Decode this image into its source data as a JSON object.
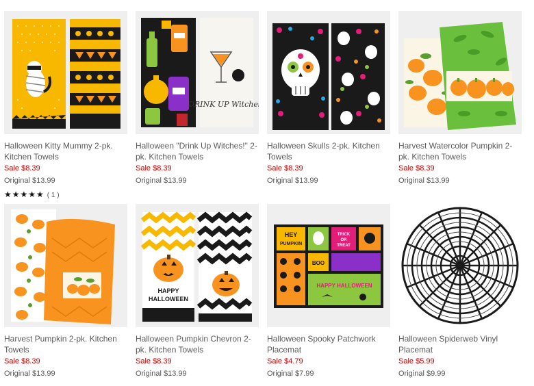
{
  "products": [
    {
      "title": "Halloween Kitty Mummy 2-pk. Kitchen Towels",
      "sale": "Sale  $8.39",
      "original": "Original  $13.99",
      "stars": "★★★★★",
      "rating_count": "( 1 )",
      "image": "kitty-mummy-towels"
    },
    {
      "title": "Halloween \"Drink Up Witches!\" 2-pk. Kitchen Towels",
      "sale": "Sale  $8.39",
      "original": "Original  $13.99",
      "image": "drink-up-witches-towels"
    },
    {
      "title": "Halloween Skulls 2-pk. Kitchen Towels",
      "sale": "Sale  $8.39",
      "original": "Original  $13.99",
      "image": "skulls-towels"
    },
    {
      "title": "Harvest Watercolor Pumpkin 2-pk. Kitchen Towels",
      "sale": "Sale  $8.39",
      "original": "Original  $13.99",
      "image": "watercolor-pumpkin-towels"
    },
    {
      "title": "Harvest Pumpkin 2-pk. Kitchen Towels",
      "sale": "Sale  $8.39",
      "original": "Original  $13.99",
      "image": "harvest-pumpkin-towels"
    },
    {
      "title": "Halloween Pumpkin Chevron 2-pk. Kitchen Towels",
      "sale": "Sale  $8.39",
      "original": "Original  $13.99",
      "image": "pumpkin-chevron-towels"
    },
    {
      "title": "Halloween Spooky Patchwork Placemat",
      "sale": "Sale  $4.79",
      "original": "Original  $7.99",
      "image": "spooky-patchwork-placemat"
    },
    {
      "title": "Halloween Spiderweb Vinyl Placemat",
      "sale": "Sale  $5.99",
      "original": "Original  $9.99",
      "image": "spiderweb-placemat"
    }
  ],
  "image_text": {
    "witches": "DRINK UP Witches!",
    "happy": "HAPPY",
    "halloween": "HALLOWEEN",
    "hey": "HEY",
    "pumpkin": "PUMPKIN",
    "boo": "BOO",
    "trick": "TRICK",
    "or": "OR",
    "treat": "TREAT",
    "happy_halloween": "HAPPY HALLOWEEN"
  },
  "colors": {
    "sale": "#cc0000",
    "text": "#5a5a5a",
    "orange": "#f7931e",
    "yellow": "#f9b800",
    "black": "#1a1a1a"
  }
}
